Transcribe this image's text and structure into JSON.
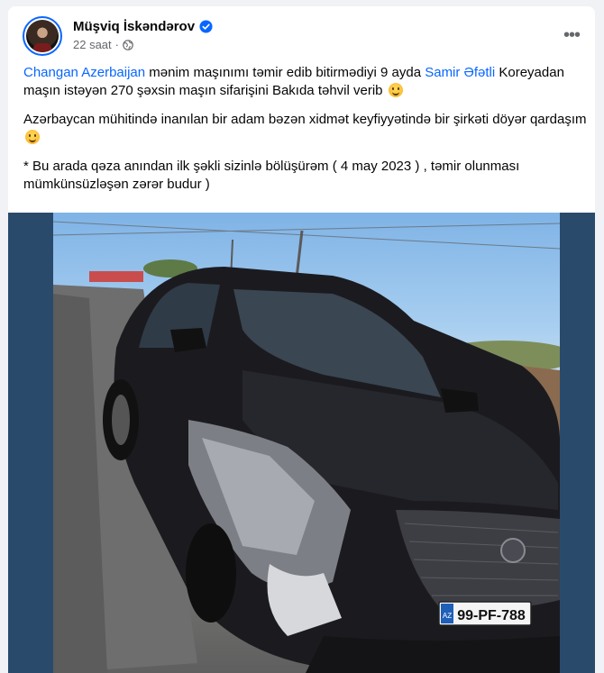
{
  "post": {
    "author": "Müşviq İskəndərov",
    "time": "22 saat",
    "separator": "·",
    "more": "•••",
    "paragraph1": {
      "link1": "Changan Azerbaijan",
      "text1": " mənim maşınımı təmir edib bitirmədiyi 9 ayda ",
      "link2": "Samir Əfətli",
      "text2": " Koreyadan maşın istəyən 270 şəxsin maşın sifarişini Bakıda təhvil verib "
    },
    "paragraph2": "Azərbaycan mühitində inanılan bir adam bəzən xidmət keyfiyyətində bir şirkəti döyər qardaşım ",
    "paragraph3": "* Bu arada qəza anından ilk  şəkli sizinlə bölüşürəm ( 4 may 2023 ) , təmir olunması mümkünsüzləşən zərər budur )"
  },
  "photo": {
    "license_plate": "99-PF-788",
    "plate_country": "AZ"
  },
  "colors": {
    "link": "#0866ff",
    "secondary_text": "#65676b",
    "background": "#f0f2f5"
  }
}
